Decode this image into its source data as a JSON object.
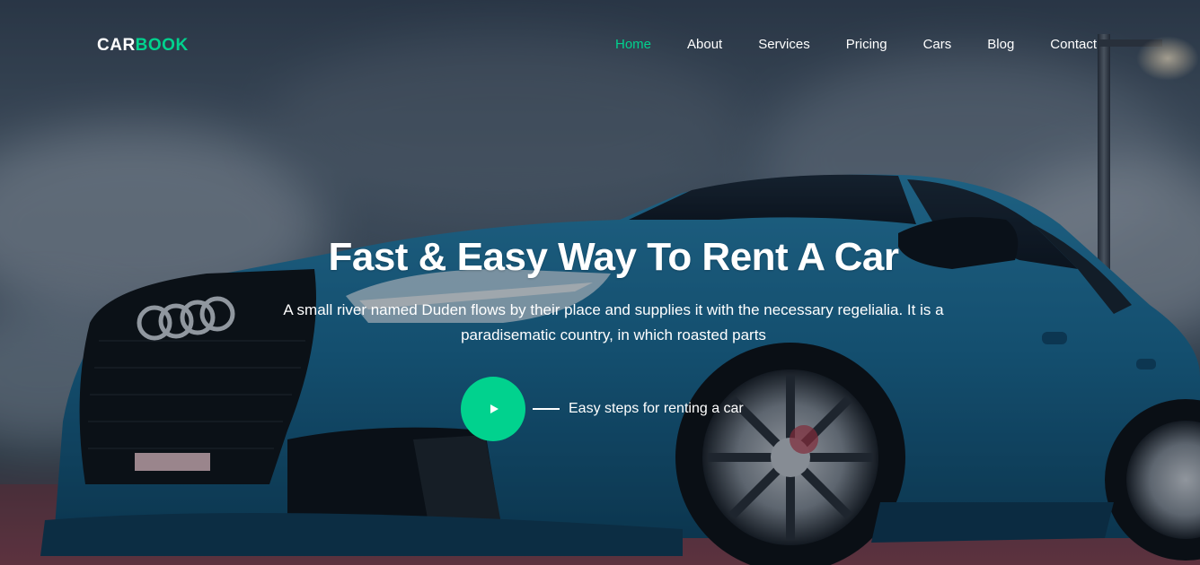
{
  "brand": {
    "name_part1": "CAR",
    "name_part2": "BOOK",
    "accent_color": "#01d28e"
  },
  "nav": {
    "items": [
      {
        "label": "Home",
        "active": true
      },
      {
        "label": "About",
        "active": false
      },
      {
        "label": "Services",
        "active": false
      },
      {
        "label": "Pricing",
        "active": false
      },
      {
        "label": "Cars",
        "active": false
      },
      {
        "label": "Blog",
        "active": false
      },
      {
        "label": "Contact",
        "active": false
      }
    ]
  },
  "hero": {
    "title": "Fast & Easy Way To Rent A Car",
    "description": "A small river named Duden flows by their place and supplies it with the necessary regelialia. It is a paradisematic country, in which roasted parts",
    "cta_text": "Easy steps for renting a car",
    "play_icon": "play-icon"
  }
}
